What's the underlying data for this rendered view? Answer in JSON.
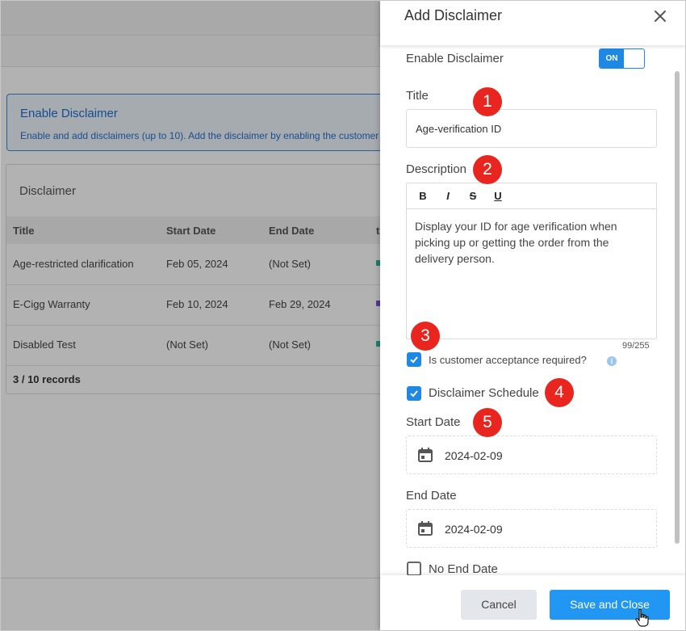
{
  "background": {
    "info_title": "Enable Disclaimer",
    "info_text": "Enable and add disclaimers (up to 10). Add the disclaimer by enabling the customer",
    "card_title": "Disclaimer",
    "columns": [
      "Title",
      "Start Date",
      "End Date",
      "t"
    ],
    "rows": [
      {
        "title": "Age-restricted clarification",
        "start": "Feb 05, 2024",
        "end": "(Not Set)",
        "dot_color": "#2bb5a0"
      },
      {
        "title": "E-Cigg Warranty",
        "start": "Feb 10, 2024",
        "end": "Feb 29, 2024",
        "dot_color": "#7b4fd8"
      },
      {
        "title": "Disabled Test",
        "start": "(Not Set)",
        "end": "(Not Set)",
        "dot_color": "#2bb5a0"
      }
    ],
    "records": "3 / 10 records"
  },
  "dialog": {
    "title": "Add Disclaimer",
    "close_icon": "close-icon",
    "enable_label": "Enable Disclaimer",
    "toggle_label": "ON",
    "title_label": "Title",
    "title_value": "Age-verification ID",
    "description_label": "Description",
    "toolbar": {
      "bold": "B",
      "italic": "I",
      "strike": "S",
      "underline": "U"
    },
    "description_value": "Display your ID for age verification when picking up or getting the order from the delivery person.",
    "char_counter": "99/255",
    "acceptance_label": "Is customer acceptance required?",
    "acceptance_checked": true,
    "info_icon": "i",
    "schedule_label": "Disclaimer Schedule",
    "schedule_checked": true,
    "start_date_label": "Start Date",
    "start_date_value": "2024-02-09",
    "end_date_label": "End Date",
    "end_date_value": "2024-02-09",
    "no_end_date_label": "No End Date",
    "no_end_date_checked": false,
    "cancel_label": "Cancel",
    "save_label": "Save and Close"
  },
  "badges": [
    "1",
    "2",
    "3",
    "4",
    "5"
  ],
  "colors": {
    "accent": "#2196f3",
    "badge": "#e8261f",
    "link": "#1c6fd1"
  }
}
